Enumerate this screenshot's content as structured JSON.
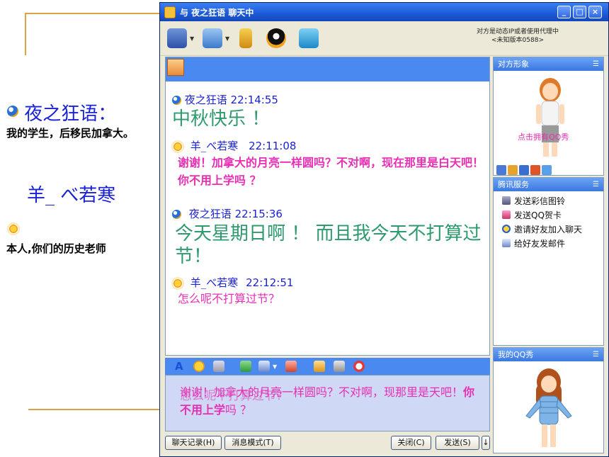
{
  "legend": {
    "user1_name": "夜之狂语：",
    "user1_desc": "我的学生，后移民加拿大。",
    "user2_name": "羊_ べ若寒",
    "user2_desc": "本人,你们的历史老师"
  },
  "window": {
    "title": "与 夜之狂语 聊天中",
    "proxy_note_line1": "对方是动态IP或者使用代理中",
    "proxy_note_line2": "<未知版本0588>"
  },
  "messages": [
    {
      "sender": "夜之狂语",
      "time": "22:14:55",
      "text": "中秋快乐 ！"
    },
    {
      "sender": "羊_べ若寒",
      "time": "22:11:08",
      "text": "谢谢！加拿大的月亮一样圆吗？不对啊，现在那里是白天吧！你不用上学吗 ？"
    },
    {
      "sender": "夜之狂语",
      "time": "22:15:36",
      "text": "今天星期日啊 ！ 而且我今天不打算过节！"
    },
    {
      "sender": "羊_べ若寒",
      "time": "22:12:51",
      "text": "怎么呢不打算过节？"
    }
  ],
  "input": {
    "ghost_text": "怎么呢不打算过节？",
    "draft_part1": "谢谢！加拿大的月亮一样圆吗？不对啊，现那里是天吧！",
    "draft_part2": "你不用上学",
    "draft_part3": "吗 ？"
  },
  "buttons": {
    "history": "聊天记录(H)",
    "msg_mode": "消息模式(T)",
    "close": "关闭(C)",
    "send": "发送(S)",
    "send_arrow": "↓"
  },
  "side": {
    "avatar_panel_title": "对方形象",
    "show_link": "点击拥有QQ秀",
    "services_title": "腾讯服务",
    "services": [
      "发送彩信图铃",
      "发送QQ贺卡",
      "邀请好友加入聊天",
      "给好友发邮件"
    ],
    "my_show_title": "我的QQ秀",
    "menu_glyph": "☰"
  },
  "colors": {
    "name_blue": "#1a22d6",
    "green_text": "#2e9a6e",
    "magenta_text": "#e62fb3",
    "xp_blue": "#4a8af0",
    "gold_line": "#d9a441"
  }
}
